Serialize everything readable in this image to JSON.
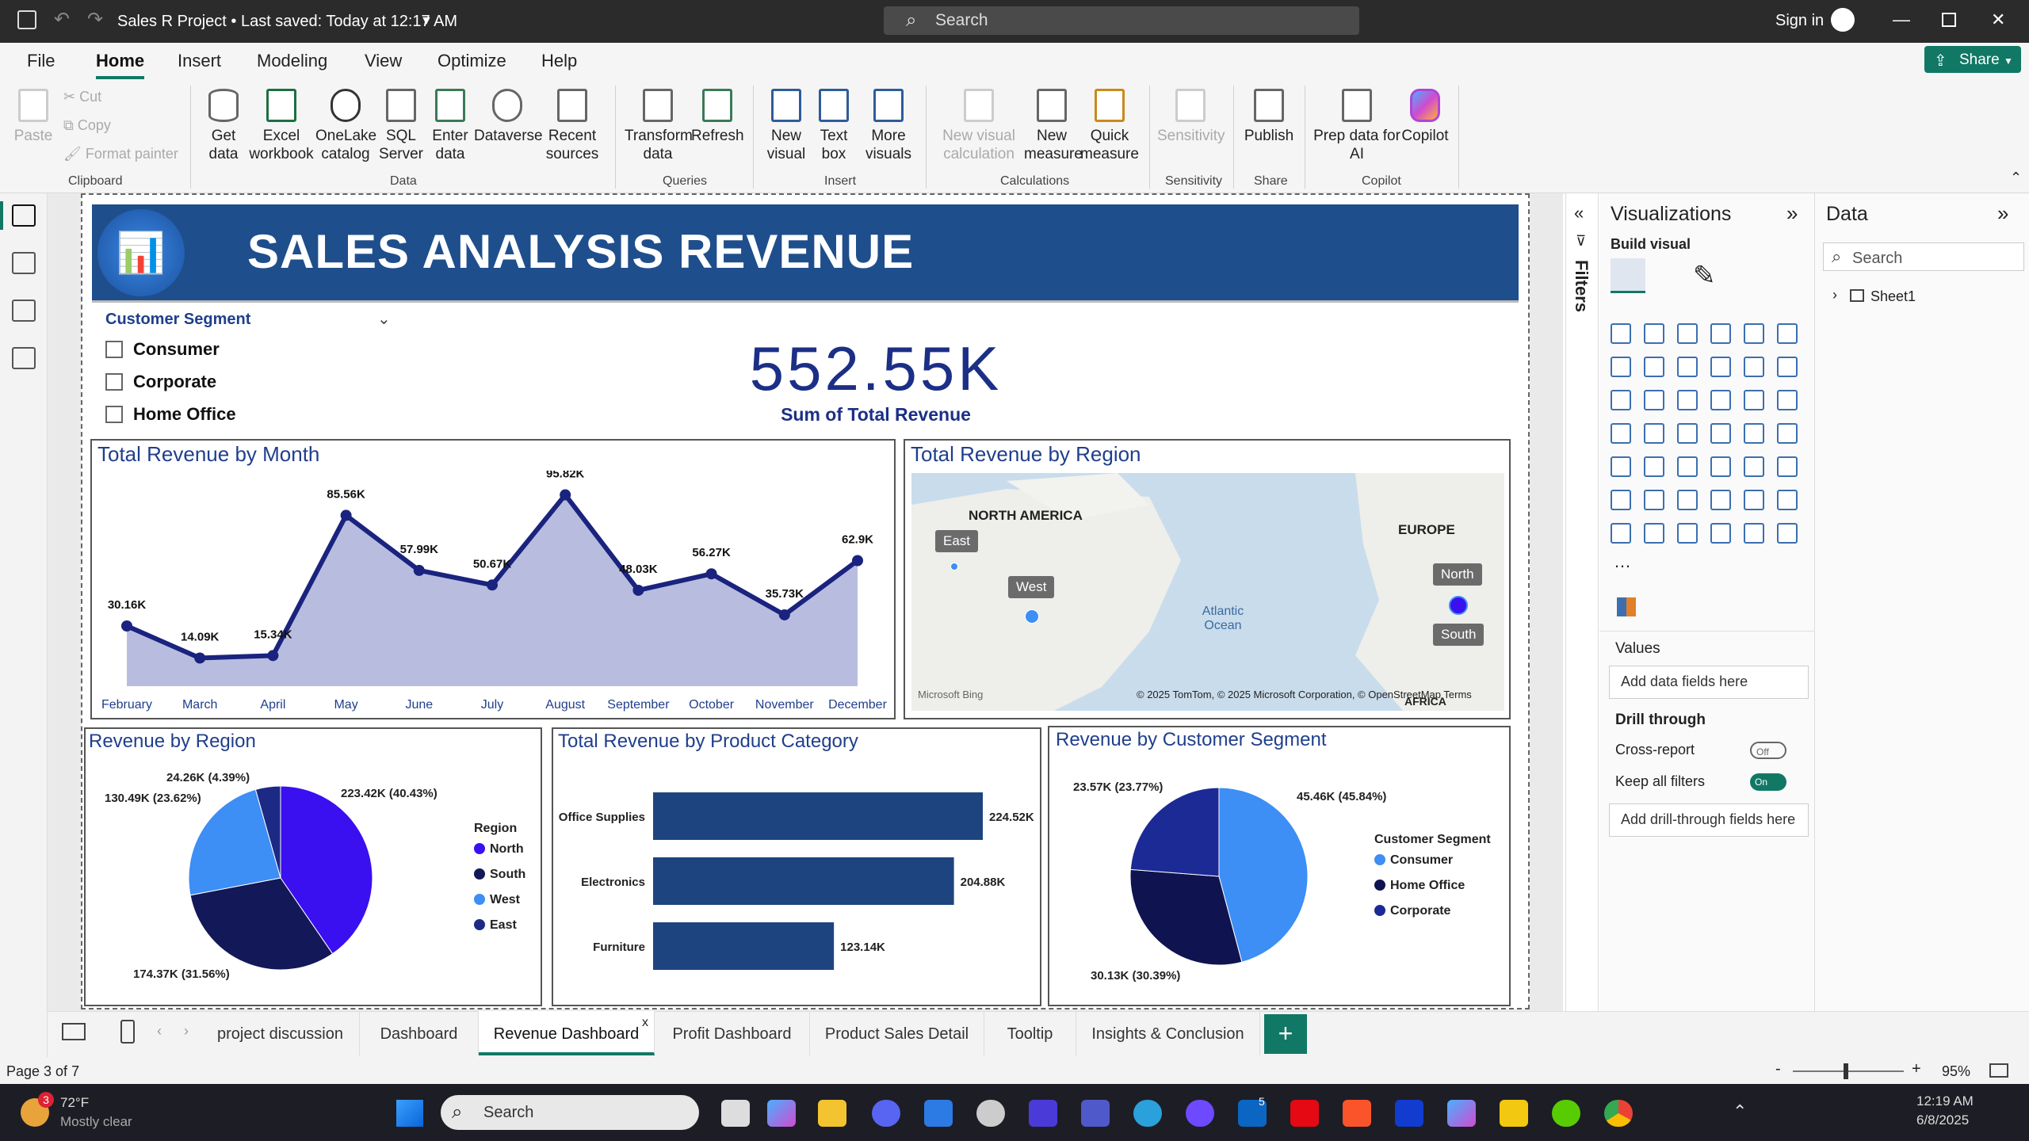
{
  "window": {
    "title": "Sales R Project  •  Last saved: Today at 12:17 AM",
    "search_placeholder": "Search",
    "sign_in": "Sign in"
  },
  "menu": [
    "File",
    "Home",
    "Insert",
    "Modeling",
    "View",
    "Optimize",
    "Help"
  ],
  "share_label": "Share",
  "ribbon": {
    "clipboard": {
      "paste": "Paste",
      "cut": "Cut",
      "copy": "Copy",
      "format_painter": "Format painter",
      "group": "Clipboard"
    },
    "data_items": [
      {
        "label": "Get data",
        "icon": "database-icon"
      },
      {
        "label": "Excel workbook",
        "icon": "excel-icon"
      },
      {
        "label": "OneLake catalog",
        "icon": "onelake-icon"
      },
      {
        "label": "SQL Server",
        "icon": "sql-server-icon"
      },
      {
        "label": "Enter data",
        "icon": "table-icon"
      },
      {
        "label": "Dataverse",
        "icon": "dataverse-icon"
      },
      {
        "label": "Recent sources",
        "icon": "recent-sources-icon"
      }
    ],
    "data_group": "Data",
    "queries_items": [
      {
        "label": "Transform data",
        "icon": "transform-icon"
      },
      {
        "label": "Refresh",
        "icon": "refresh-icon"
      }
    ],
    "queries_group": "Queries",
    "insert_items": [
      {
        "label": "New visual",
        "icon": "new-visual-icon"
      },
      {
        "label": "Text box",
        "icon": "text-box-icon"
      },
      {
        "label": "More visuals",
        "icon": "more-visuals-icon"
      }
    ],
    "insert_group": "Insert",
    "calc_items": [
      {
        "label": "New visual calculation",
        "icon": "visual-calc-icon"
      },
      {
        "label": "New measure",
        "icon": "calculator-icon"
      },
      {
        "label": "Quick measure",
        "icon": "quick-measure-icon"
      }
    ],
    "calc_group": "Calculations",
    "sensitivity": "Sensitivity",
    "sensitivity_group": "Sensitivity",
    "publish": "Publish",
    "share_group": "Share",
    "copilot_items": [
      {
        "label": "Prep data for AI",
        "icon": "prep-data-icon"
      },
      {
        "label": "Copilot",
        "icon": "copilot-icon"
      }
    ],
    "copilot_group": "Copilot"
  },
  "report": {
    "banner_title": "SALES ANALYSIS REVENUE",
    "slicer": {
      "title": "Customer Segment",
      "options": [
        "Consumer",
        "Corporate",
        "Home Office"
      ]
    },
    "kpi": {
      "value": "552.55K",
      "label": "Sum of Total Revenue"
    },
    "month_chart_title": "Total Revenue by Month",
    "region_map_title": "Total Revenue by Region",
    "map": {
      "labels": [
        "NORTH AMERICA",
        "EUROPE",
        "Atlantic Ocean",
        "AFRICA"
      ],
      "tags": [
        "East",
        "West",
        "North",
        "South"
      ],
      "bing": "Microsoft Bing",
      "copyright": "© 2025 TomTom, © 2025 Microsoft Corporation, © OpenStreetMap  Terms"
    },
    "region_pie_title": "Revenue by Region",
    "category_title": "Total Revenue by Product Category",
    "segment_pie_title": "Revenue by Customer Segment"
  },
  "chart_data": [
    {
      "type": "area",
      "title": "Total Revenue by Month",
      "categories": [
        "February",
        "March",
        "April",
        "May",
        "June",
        "July",
        "August",
        "September",
        "October",
        "November",
        "December"
      ],
      "values": [
        30.16,
        14.09,
        15.34,
        85.56,
        57.99,
        50.67,
        95.82,
        48.03,
        56.27,
        35.73,
        62.9
      ],
      "data_labels": [
        "30.16K",
        "14.09K",
        "15.34K",
        "85.56K",
        "57.99K",
        "50.67K",
        "95.82K",
        "48.03K",
        "56.27K",
        "35.73K",
        "62.9K"
      ],
      "ylim": [
        0,
        100
      ],
      "color": "#1a237e",
      "fill": "#b8bde0"
    },
    {
      "type": "pie",
      "title": "Revenue by Region",
      "legend_title": "Region",
      "categories": [
        "North",
        "South",
        "West",
        "East"
      ],
      "values": [
        223.42,
        174.37,
        130.49,
        24.26
      ],
      "data_labels": [
        "223.42K (40.43%)",
        "174.37K (31.56%)",
        "130.49K (23.62%)",
        "24.26K (4.39%)"
      ],
      "colors": [
        "#3a0ff0",
        "#121858",
        "#3d8ef5",
        "#1c2a86"
      ],
      "legend": "right"
    },
    {
      "type": "bar",
      "orientation": "horizontal",
      "title": "Total Revenue by Product Category",
      "categories": [
        "Office Supplies",
        "Electronics",
        "Furniture"
      ],
      "values": [
        224.52,
        204.88,
        123.14
      ],
      "data_labels": [
        "224.52K",
        "204.88K",
        "123.14K"
      ],
      "xlim": [
        0,
        224.52
      ],
      "color": "#1e4480"
    },
    {
      "type": "pie",
      "title": "Revenue by Customer Segment",
      "legend_title": "Customer Segment",
      "categories": [
        "Consumer",
        "Home Office",
        "Corporate"
      ],
      "values": [
        45.46,
        30.13,
        23.57
      ],
      "data_labels": [
        "45.46K (45.84%)",
        "30.13K (30.39%)",
        "23.57K (23.77%)"
      ],
      "colors": [
        "#3d8ef5",
        "#0f1450",
        "#1c2a96"
      ],
      "legend": "right"
    }
  ],
  "filters_label": "Filters",
  "visualizations": {
    "title": "Visualizations",
    "build_visual": "Build visual",
    "values": "Values",
    "add_data_fields": "Add data fields here",
    "drill_through": "Drill through",
    "cross_report": "Cross-report",
    "cross_report_state": "Off",
    "keep_all_filters": "Keep all filters",
    "keep_all_filters_state": "On",
    "add_drill": "Add drill-through fields here"
  },
  "data_pane": {
    "title": "Data",
    "search_placeholder": "Search",
    "table": "Sheet1"
  },
  "tabs": [
    "project discussion",
    "Dashboard",
    "Revenue Dashboard",
    "Profit Dashboard",
    "Product Sales Detail",
    "Tooltip",
    "Insights & Conclusion"
  ],
  "active_tab": "Revenue Dashboard",
  "status": {
    "page": "Page 3 of 7",
    "zoom": "95%"
  },
  "taskbar": {
    "weather_temp": "72°F",
    "weather_desc": "Mostly clear",
    "weather_badge": "3",
    "search": "Search",
    "time": "12:19 AM",
    "date": "6/8/2025",
    "linkedin_badge": "5"
  }
}
